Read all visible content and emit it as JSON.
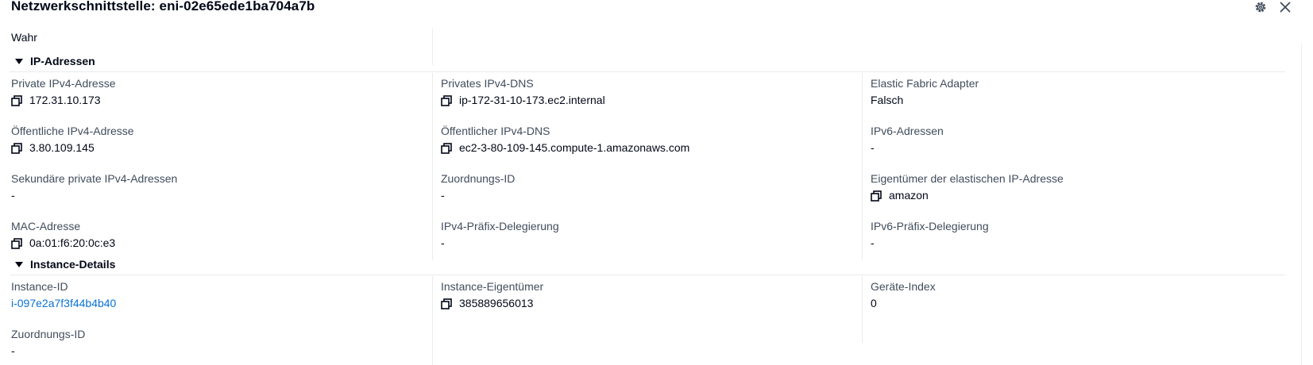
{
  "header": {
    "title": "Netzwerkschnittstelle: eni-02e65ede1ba704a7b",
    "settings_icon": "gear-icon",
    "close_icon": "close-icon"
  },
  "top_value": "Wahr",
  "ip_section": {
    "title": "IP-Adressen",
    "fields": [
      {
        "label": "Private IPv4-Adresse",
        "value": "172.31.10.173",
        "copyable": true
      },
      {
        "label": "Privates IPv4-DNS",
        "value": "ip-172-31-10-173.ec2.internal",
        "copyable": true
      },
      {
        "label": "Elastic Fabric Adapter",
        "value": "Falsch",
        "copyable": false
      },
      {
        "label": "Öffentliche IPv4-Adresse",
        "value": "3.80.109.145",
        "copyable": true
      },
      {
        "label": "Öffentlicher IPv4-DNS",
        "value": "ec2-3-80-109-145.compute-1.amazonaws.com",
        "copyable": true
      },
      {
        "label": "IPv6-Adressen",
        "value": "-",
        "copyable": false
      },
      {
        "label": "Sekundäre private IPv4-Adressen",
        "value": "-",
        "copyable": false
      },
      {
        "label": "Zuordnungs-ID",
        "value": "-",
        "copyable": false
      },
      {
        "label": "Eigentümer der elastischen IP-Adresse",
        "value": "amazon",
        "copyable": true
      },
      {
        "label": "MAC-Adresse",
        "value": "0a:01:f6:20:0c:e3",
        "copyable": true
      },
      {
        "label": "IPv4-Präfix-Delegierung",
        "value": "-",
        "copyable": false
      },
      {
        "label": "IPv6-Präfix-Delegierung",
        "value": "-",
        "copyable": false
      }
    ]
  },
  "instance_section": {
    "title": "Instance-Details",
    "fields": [
      {
        "label": "Instance-ID",
        "value": "i-097e2a7f3f44b4b40",
        "link": true
      },
      {
        "label": "Instance-Eigentümer",
        "value": "385889656013",
        "copyable": true
      },
      {
        "label": "Geräte-Index",
        "value": "0",
        "copyable": false
      },
      {
        "label": "Zuordnungs-ID",
        "value": "-",
        "copyable": false
      }
    ]
  },
  "colors": {
    "link": "#0972d3",
    "label": "#414d5c",
    "text": "#000716",
    "divider": "#e9ebed"
  }
}
